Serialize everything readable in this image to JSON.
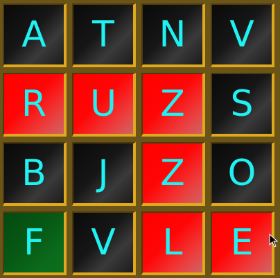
{
  "board": {
    "rows": [
      [
        {
          "letter": "A",
          "state": "black"
        },
        {
          "letter": "T",
          "state": "black"
        },
        {
          "letter": "N",
          "state": "black"
        },
        {
          "letter": "V",
          "state": "black"
        }
      ],
      [
        {
          "letter": "R",
          "state": "red"
        },
        {
          "letter": "U",
          "state": "red"
        },
        {
          "letter": "Z",
          "state": "red"
        },
        {
          "letter": "S",
          "state": "black"
        }
      ],
      [
        {
          "letter": "B",
          "state": "black"
        },
        {
          "letter": "J",
          "state": "black"
        },
        {
          "letter": "Z",
          "state": "red"
        },
        {
          "letter": "O",
          "state": "black"
        }
      ],
      [
        {
          "letter": "F",
          "state": "green"
        },
        {
          "letter": "V",
          "state": "black"
        },
        {
          "letter": "L",
          "state": "red"
        },
        {
          "letter": "E",
          "state": "red"
        }
      ]
    ]
  },
  "colors": {
    "frame": "#6b5418",
    "letter": "#1ff2f2",
    "selected": "#ff0000",
    "start": "#075915",
    "unselected": "#111111"
  },
  "cursor_icon": "mouse-pointer-icon"
}
